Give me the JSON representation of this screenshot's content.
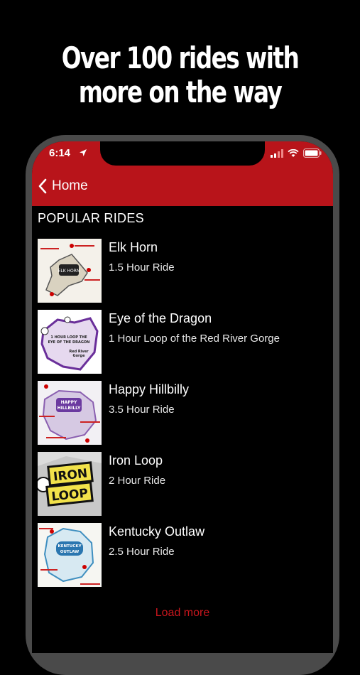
{
  "promo": {
    "line1": "Over 100 rides with",
    "line2": "more on the way"
  },
  "status_bar": {
    "time": "6:14",
    "icons": [
      "location-arrow-icon",
      "signal-icon",
      "wifi-icon",
      "battery-icon"
    ]
  },
  "nav": {
    "back_label": "Home",
    "accent_color": "#b8141a"
  },
  "section": {
    "title": "POPULAR RIDES"
  },
  "rides": [
    {
      "name": "Elk Horn",
      "subtitle": "1.5 Hour Ride",
      "thumb": "elk-horn-map"
    },
    {
      "name": "Eye of the Dragon",
      "subtitle": "1 Hour Loop of the Red River Gorge",
      "thumb": "eye-of-the-dragon-map"
    },
    {
      "name": "Happy Hillbilly",
      "subtitle": "3.5 Hour Ride",
      "thumb": "happy-hillbilly-map"
    },
    {
      "name": "Iron Loop",
      "subtitle": "2 Hour Ride",
      "thumb": "iron-loop-map"
    },
    {
      "name": "Kentucky Outlaw",
      "subtitle": "2.5 Hour Ride",
      "thumb": "kentucky-outlaw-map"
    }
  ],
  "load_more": "Load more",
  "thumb_labels": {
    "elk_horn": "ELK HORN",
    "dragon_line1": "1 HOUR LOOP THE",
    "dragon_line2": "EYE OF THE DRAGON",
    "dragon_line3": "Red River",
    "dragon_line4": "Gorge",
    "hillbilly_line1": "HAPPY",
    "hillbilly_line2": "HILLBILLY",
    "iron_line1": "IRON",
    "iron_line2": "LOOP",
    "outlaw_line1": "KENTUCKY",
    "outlaw_line2": "OUTLAW"
  }
}
